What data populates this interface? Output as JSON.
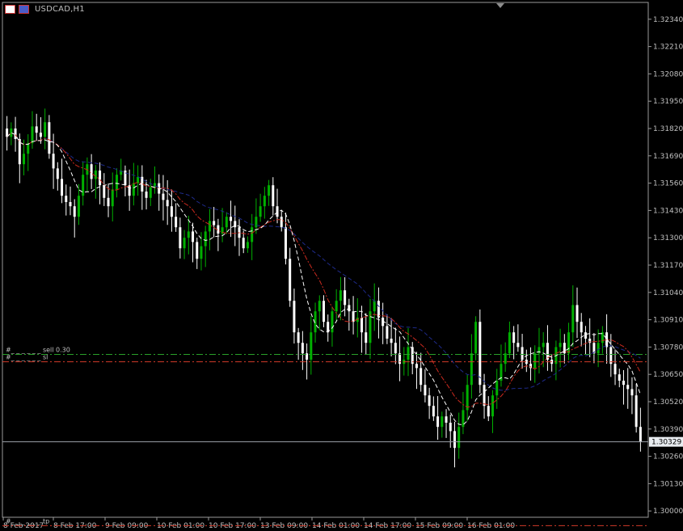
{
  "header": {
    "symbol_title": "USDCAD,H1"
  },
  "colors": {
    "background": "#000000",
    "axis": "#9a9a9a",
    "text": "#c0c0c0",
    "bull": "#00b000",
    "bear": "#ffffff",
    "ma_fast": "#ffffff",
    "ma_mid": "#cc2a1f",
    "ma_slow": "#1e2a8a",
    "order_sell": "#2aa02a",
    "order_sl": "#d23a2a",
    "order_tp": "#d23a2a",
    "bid_line": "#9aa0a8"
  },
  "chart_data": {
    "type": "candlestick",
    "symbol": "USDCAD",
    "timeframe": "H1",
    "grid": false,
    "y_ticks": [
      "1.32340",
      "1.32210",
      "1.32080",
      "1.31950",
      "1.31820",
      "1.31690",
      "1.31560",
      "1.31430",
      "1.31300",
      "1.31170",
      "1.31040",
      "1.30910",
      "1.30780",
      "1.30650",
      "1.30520",
      "1.30390",
      "1.30260",
      "1.30130",
      "1.30000"
    ],
    "x_ticks": [
      "8 Feb 2017",
      "8 Feb 17:00",
      "9 Feb 09:00",
      "10 Feb 01:00",
      "10 Feb 17:00",
      "13 Feb 09:00",
      "14 Feb 01:00",
      "14 Feb 17:00",
      "15 Feb 09:00",
      "16 Feb 01:00"
    ],
    "ylim": [
      1.2997,
      1.3242
    ],
    "current_price": "1.30329",
    "closes": [
      1.3178,
      1.3182,
      1.3177,
      1.3165,
      1.317,
      1.3175,
      1.3183,
      1.318,
      1.3178,
      1.3185,
      1.317,
      1.3163,
      1.3158,
      1.315,
      1.3147,
      1.3145,
      1.314,
      1.315,
      1.316,
      1.3165,
      1.3158,
      1.3162,
      1.3155,
      1.3149,
      1.3145,
      1.3153,
      1.316,
      1.3162,
      1.3155,
      1.315,
      1.3156,
      1.3159,
      1.3152,
      1.3149,
      1.3154,
      1.3156,
      1.3151,
      1.3148,
      1.3145,
      1.314,
      1.3135,
      1.3125,
      1.313,
      1.3133,
      1.3128,
      1.312,
      1.3126,
      1.3133,
      1.3138,
      1.3136,
      1.3132,
      1.3135,
      1.314,
      1.3138,
      1.3135,
      1.313,
      1.3125,
      1.3128,
      1.3135,
      1.314,
      1.3145,
      1.315,
      1.3155,
      1.3145,
      1.314,
      1.3135,
      1.312,
      1.31,
      1.3085,
      1.308,
      1.3075,
      1.3072,
      1.3085,
      1.3095,
      1.31,
      1.309,
      1.3085,
      1.3095,
      1.31,
      1.3105,
      1.3098,
      1.3095,
      1.309,
      1.3092,
      1.3085,
      1.308,
      1.3095,
      1.31,
      1.3092,
      1.3088,
      1.3082,
      1.308,
      1.3075,
      1.307,
      1.3072,
      1.3078,
      1.307,
      1.3068,
      1.306,
      1.3055,
      1.305,
      1.3045,
      1.304,
      1.3045,
      1.3042,
      1.3038,
      1.303,
      1.304,
      1.3048,
      1.306,
      1.3075,
      1.309,
      1.306,
      1.305,
      1.3045,
      1.3055,
      1.3062,
      1.307,
      1.3075,
      1.3085,
      1.308,
      1.3078,
      1.3072,
      1.307,
      1.3068,
      1.3075,
      1.3078,
      1.308,
      1.3072,
      1.307,
      1.3078,
      1.308,
      1.3075,
      1.3085,
      1.3098,
      1.309,
      1.3085,
      1.3082,
      1.308,
      1.3075,
      1.308,
      1.3085,
      1.3078,
      1.307,
      1.3065,
      1.3062,
      1.306,
      1.3058,
      1.3055,
      1.304,
      1.3033
    ],
    "ma_fast": {
      "period": 8,
      "style": "dashed",
      "color": "#ffffff"
    },
    "ma_mid": {
      "period": 14,
      "style": "dash-dot",
      "color": "#cc2a1f"
    },
    "ma_slow": {
      "period": 26,
      "style": "dashed",
      "color": "#1e2a8a"
    },
    "orders": [
      {
        "kind": "sell",
        "text": "#_ _ _ _ _ _ sell 0.30",
        "price": 1.30745,
        "color": "#2aa02a"
      },
      {
        "kind": "sl",
        "text": "#_ _ _ _ _ _ sl",
        "price": 1.3071,
        "color": "#d23a2a"
      },
      {
        "kind": "tp",
        "text": "#_ _ _ _ _ _ tp",
        "price": 1.2993,
        "color": "#d23a2a"
      }
    ]
  }
}
